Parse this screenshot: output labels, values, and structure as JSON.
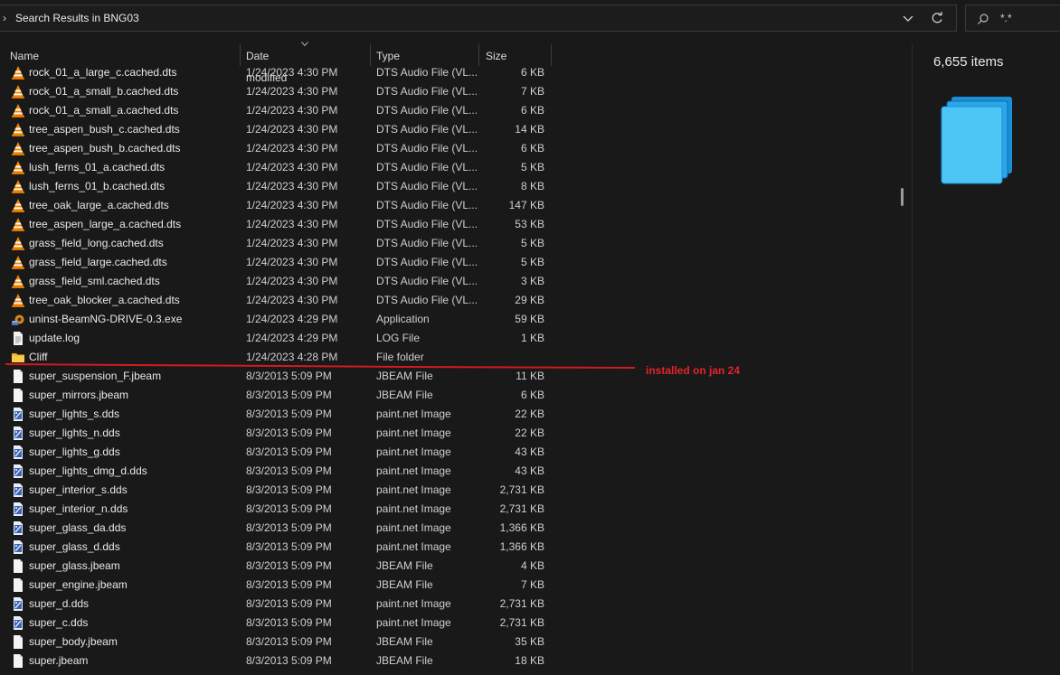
{
  "address_bar": {
    "breadcrumb": "Search Results in BNG03"
  },
  "search": {
    "query": "*.*"
  },
  "columns": {
    "name": "Name",
    "date": "Date modified",
    "type": "Type",
    "size": "Size"
  },
  "details_pane": {
    "item_count": "6,655 items"
  },
  "annotation": {
    "text": "installed on jan 24",
    "color": "#e0252b"
  },
  "rows": [
    {
      "name": "rock_01_a_large_c.cached.dts",
      "date": "1/24/2023 4:30 PM",
      "type": "DTS Audio File (VL...",
      "size": "6 KB",
      "icon": "vlc-cone-icon"
    },
    {
      "name": "rock_01_a_small_b.cached.dts",
      "date": "1/24/2023 4:30 PM",
      "type": "DTS Audio File (VL...",
      "size": "7 KB",
      "icon": "vlc-cone-icon"
    },
    {
      "name": "rock_01_a_small_a.cached.dts",
      "date": "1/24/2023 4:30 PM",
      "type": "DTS Audio File (VL...",
      "size": "6 KB",
      "icon": "vlc-cone-icon"
    },
    {
      "name": "tree_aspen_bush_c.cached.dts",
      "date": "1/24/2023 4:30 PM",
      "type": "DTS Audio File (VL...",
      "size": "14 KB",
      "icon": "vlc-cone-icon"
    },
    {
      "name": "tree_aspen_bush_b.cached.dts",
      "date": "1/24/2023 4:30 PM",
      "type": "DTS Audio File (VL...",
      "size": "6 KB",
      "icon": "vlc-cone-icon"
    },
    {
      "name": "lush_ferns_01_a.cached.dts",
      "date": "1/24/2023 4:30 PM",
      "type": "DTS Audio File (VL...",
      "size": "5 KB",
      "icon": "vlc-cone-icon"
    },
    {
      "name": "lush_ferns_01_b.cached.dts",
      "date": "1/24/2023 4:30 PM",
      "type": "DTS Audio File (VL...",
      "size": "8 KB",
      "icon": "vlc-cone-icon"
    },
    {
      "name": "tree_oak_large_a.cached.dts",
      "date": "1/24/2023 4:30 PM",
      "type": "DTS Audio File (VL...",
      "size": "147 KB",
      "icon": "vlc-cone-icon"
    },
    {
      "name": "tree_aspen_large_a.cached.dts",
      "date": "1/24/2023 4:30 PM",
      "type": "DTS Audio File (VL...",
      "size": "53 KB",
      "icon": "vlc-cone-icon"
    },
    {
      "name": "grass_field_long.cached.dts",
      "date": "1/24/2023 4:30 PM",
      "type": "DTS Audio File (VL...",
      "size": "5 KB",
      "icon": "vlc-cone-icon"
    },
    {
      "name": "grass_field_large.cached.dts",
      "date": "1/24/2023 4:30 PM",
      "type": "DTS Audio File (VL...",
      "size": "5 KB",
      "icon": "vlc-cone-icon"
    },
    {
      "name": "grass_field_sml.cached.dts",
      "date": "1/24/2023 4:30 PM",
      "type": "DTS Audio File (VL...",
      "size": "3 KB",
      "icon": "vlc-cone-icon"
    },
    {
      "name": "tree_oak_blocker_a.cached.dts",
      "date": "1/24/2023 4:30 PM",
      "type": "DTS Audio File (VL...",
      "size": "29 KB",
      "icon": "vlc-cone-icon"
    },
    {
      "name": "uninst-BeamNG-DRIVE-0.3.exe",
      "date": "1/24/2023 4:29 PM",
      "type": "Application",
      "size": "59 KB",
      "icon": "uninstaller-icon"
    },
    {
      "name": "update.log",
      "date": "1/24/2023 4:29 PM",
      "type": "LOG File",
      "size": "1 KB",
      "icon": "text-file-icon"
    },
    {
      "name": "Cliff",
      "date": "1/24/2023 4:28 PM",
      "type": "File folder",
      "size": "",
      "icon": "folder-icon"
    },
    {
      "name": "super_suspension_F.jbeam",
      "date": "8/3/2013 5:09 PM",
      "type": "JBEAM File",
      "size": "11 KB",
      "icon": "blank-file-icon"
    },
    {
      "name": "super_mirrors.jbeam",
      "date": "8/3/2013 5:09 PM",
      "type": "JBEAM File",
      "size": "6 KB",
      "icon": "blank-file-icon"
    },
    {
      "name": "super_lights_s.dds",
      "date": "8/3/2013 5:09 PM",
      "type": "paint.net Image",
      "size": "22 KB",
      "icon": "paintnet-image-icon"
    },
    {
      "name": "super_lights_n.dds",
      "date": "8/3/2013 5:09 PM",
      "type": "paint.net Image",
      "size": "22 KB",
      "icon": "paintnet-image-icon"
    },
    {
      "name": "super_lights_g.dds",
      "date": "8/3/2013 5:09 PM",
      "type": "paint.net Image",
      "size": "43 KB",
      "icon": "paintnet-image-icon"
    },
    {
      "name": "super_lights_dmg_d.dds",
      "date": "8/3/2013 5:09 PM",
      "type": "paint.net Image",
      "size": "43 KB",
      "icon": "paintnet-image-icon"
    },
    {
      "name": "super_interior_s.dds",
      "date": "8/3/2013 5:09 PM",
      "type": "paint.net Image",
      "size": "2,731 KB",
      "icon": "paintnet-image-icon"
    },
    {
      "name": "super_interior_n.dds",
      "date": "8/3/2013 5:09 PM",
      "type": "paint.net Image",
      "size": "2,731 KB",
      "icon": "paintnet-image-icon"
    },
    {
      "name": "super_glass_da.dds",
      "date": "8/3/2013 5:09 PM",
      "type": "paint.net Image",
      "size": "1,366 KB",
      "icon": "paintnet-image-icon"
    },
    {
      "name": "super_glass_d.dds",
      "date": "8/3/2013 5:09 PM",
      "type": "paint.net Image",
      "size": "1,366 KB",
      "icon": "paintnet-image-icon"
    },
    {
      "name": "super_glass.jbeam",
      "date": "8/3/2013 5:09 PM",
      "type": "JBEAM File",
      "size": "4 KB",
      "icon": "blank-file-icon"
    },
    {
      "name": "super_engine.jbeam",
      "date": "8/3/2013 5:09 PM",
      "type": "JBEAM File",
      "size": "7 KB",
      "icon": "blank-file-icon"
    },
    {
      "name": "super_d.dds",
      "date": "8/3/2013 5:09 PM",
      "type": "paint.net Image",
      "size": "2,731 KB",
      "icon": "paintnet-image-icon"
    },
    {
      "name": "super_c.dds",
      "date": "8/3/2013 5:09 PM",
      "type": "paint.net Image",
      "size": "2,731 KB",
      "icon": "paintnet-image-icon"
    },
    {
      "name": "super_body.jbeam",
      "date": "8/3/2013 5:09 PM",
      "type": "JBEAM File",
      "size": "35 KB",
      "icon": "blank-file-icon"
    },
    {
      "name": "super.jbeam",
      "date": "8/3/2013 5:09 PM",
      "type": "JBEAM File",
      "size": "18 KB",
      "icon": "blank-file-icon"
    }
  ]
}
